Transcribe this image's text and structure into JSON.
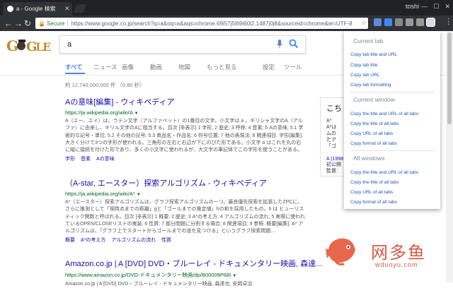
{
  "window": {
    "tab_title": "a - Google 検索",
    "profile": "toshi"
  },
  "omnibox": {
    "secure_label": "Secure",
    "url": "https://www.google.co.jp/search?q=a&oq=a&aqs=chrome.69i57j5l69i60l2.1487j0j8&sourceid=chrome&ie=UTF-8"
  },
  "search": {
    "query": "a"
  },
  "google_tabs": [
    "すべて",
    "ニュース",
    "画像",
    "動画",
    "地図",
    "もっと見る"
  ],
  "google_tabs_right": [
    "設定",
    "ツール"
  ],
  "stats": "約 12,740,000,000 件 （0.80 秒）",
  "results": [
    {
      "title": "Aの意味[編集] - ウィキペディア",
      "url": "https://ja.wikipedia.org/wiki/A",
      "snippet": "A（エー、エイ）は、ラテン文字（アルファベット）の1番目の文字。小文字は a 。ギリシャ文字のΑ（アルファ）に由来し、キリル文字のАに相当する。目次 [非表示] 1 字形; 2 歴史; 3 呼称; 4 音素; 5 Aの意味; 5.1 学術的な記号・単位; 5.2 その他の記号; 5.3 商品名・作品名; 6 符号位置; 7 他の表現法; 8 関連項目. 字形[編集]. 大きく分けて3つの字形が使われる。三角形の左右と右辺が下にのびた形である。小文字 a はこれを丸の右に縦に接続を付けた形であり、多くの小文字に使われるが、大文字の筆記体でこの字形を使うことがある。",
      "links": [
        "字形",
        "音素",
        "Aの意味"
      ]
    },
    {
      "title": "（A-star, エースター）探索アルゴリズム - ウィキペディア",
      "url": "https://ja.wikipedia.org/wiki/A*",
      "snippet": "A*（エースター）探索アルゴリズムは、グラフ探索アルゴリズムの一つ。最良優先探索を拡張したZPCに、さらに推測として「現時点までの距離」gと「ゴールまでの推定値」hの和を採用したもの。h は ヒューリスティック関数と呼ばれる。目次 [非表示] 1 概要; 2 歴史; 3 A*の考え方; 4 アルゴリズムの流れ; 5 実際に使われているOPEN/CLOSEリストの実装; 6 性質; 7 部分問題に分割する場合; 8 関連項目; 9 参照. 概要[編集]. A* アルゴリズムは、「グラフ上でスタートからゴールまでの道を見つける」というグラフ探索問題...",
      "links": [
        "概要",
        "A*の考え方",
        "アルゴリズムの流れ",
        "性質"
      ]
    },
    {
      "title": "Amazon.co.jp | A [DVD] DVD・ブルーレイ - ドキュメンタリー映画, 森達...",
      "url": "https://www.amazon.co.jp/DVD-ドキュメンタリー映画/dp/B00009P68I",
      "snippet": "Amazon.co.jp | A [DVD] DVD・ブルーレイ - ドキュメンタリー映画, 森達也, 安岡卓治"
    }
  ],
  "knowledge_panel": {
    "heading": "こち",
    "lines": [
      "A*",
      "A*は",
      "ムの",
      "たア",
      "「ゴ"
    ],
    "link": "A (1998",
    "meta": [
      "初公開",
      "監督："
    ]
  },
  "popup": {
    "sections": [
      {
        "title": "Current tab",
        "items": [
          "Copy tab title and URL",
          "Copy tab title",
          "Copy tab URL",
          "Copy tab formatting"
        ]
      },
      {
        "title": "Current window",
        "items": [
          "Copy the title and URL of all tabs",
          "Copy the title of all tabs",
          "Copy URL of all tabs",
          "Copy format of all tabs"
        ]
      },
      {
        "title": "All windows",
        "items": [
          "Copy the title and URL of all tabs",
          "Copy the title of all tabs",
          "Copy URL of all tabs",
          "Copy format of all tabs"
        ]
      }
    ]
  },
  "watermark": {
    "text": "网多鱼",
    "url": "wduoyu.com"
  },
  "colors": {
    "link": "#1a0dab",
    "url_green": "#006621",
    "google_blue": "#4285f4",
    "popup_link": "#1a55b8",
    "watermark": "#d55b42"
  }
}
